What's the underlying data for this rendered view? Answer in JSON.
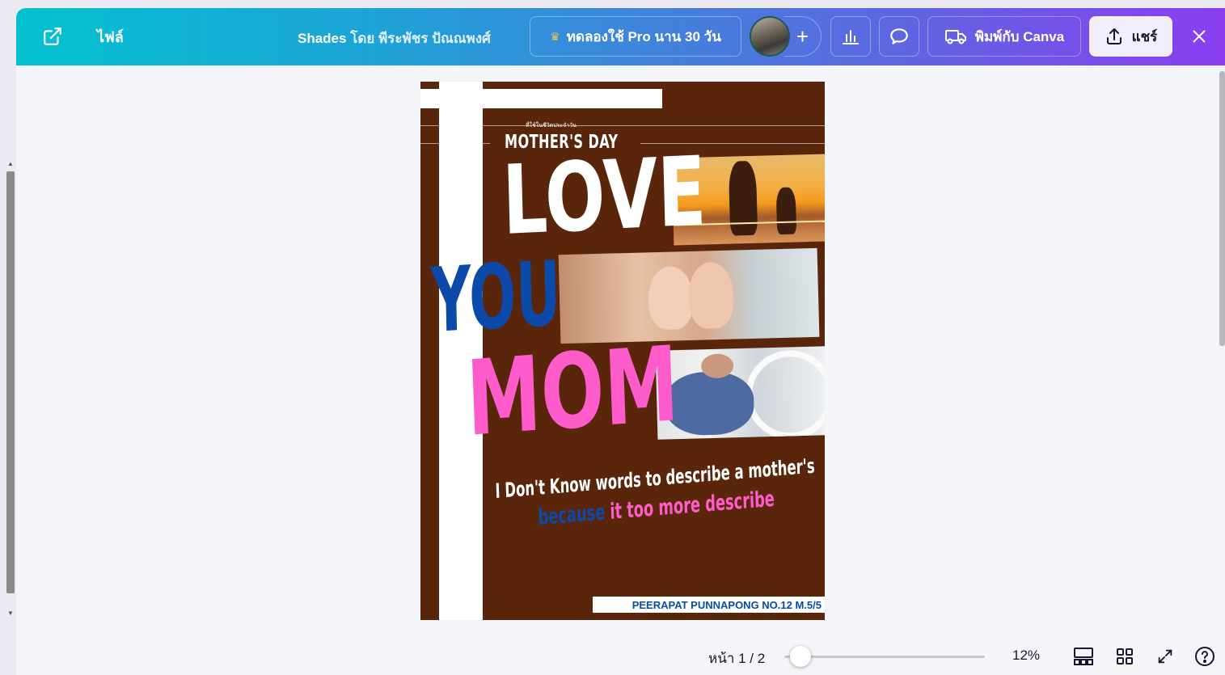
{
  "header": {
    "file_label": "ไฟล์",
    "design_name": "Shades",
    "by_label": "โดย",
    "author_name": "พีระพัชร ปัณณพงศ์",
    "pro_trial_label": "ทดลองใช้ Pro นาน 30 วัน",
    "print_label": "พิมพ์กับ Canva",
    "share_label": "แชร์"
  },
  "design": {
    "small_thai_text": "ที่ใช้ในชีวิตประจำวัน",
    "title_small": "MOTHER'S DAY",
    "word_love": "LOVE",
    "word_you": "YOU",
    "word_mom": "MOM",
    "quote_line1": "I Don't Know  words to describe a mother's",
    "quote_line2_blue": "because",
    "quote_line2_pink": "it too more describe",
    "author_credit": "PEERAPAT PUNNAPONG NO.12 M.5/5",
    "colors": {
      "background": "#5a260b",
      "blue": "#0b4aa8",
      "pink": "#ff5ccb",
      "white": "#ffffff"
    }
  },
  "footer": {
    "page_label": "หน้า 1 / 2",
    "zoom_label": "12%",
    "zoom_percent": 12
  },
  "icons": {
    "external": "external-link-icon",
    "crown": "crown-icon",
    "plus": "plus-icon",
    "stats": "bar-chart-icon",
    "comment": "comment-icon",
    "truck": "truck-icon",
    "upload": "upload-icon",
    "close": "close-icon",
    "thumbnails": "page-thumbnails-icon",
    "grid": "grid-view-icon",
    "fullscreen": "fullscreen-icon",
    "help": "help-icon"
  }
}
